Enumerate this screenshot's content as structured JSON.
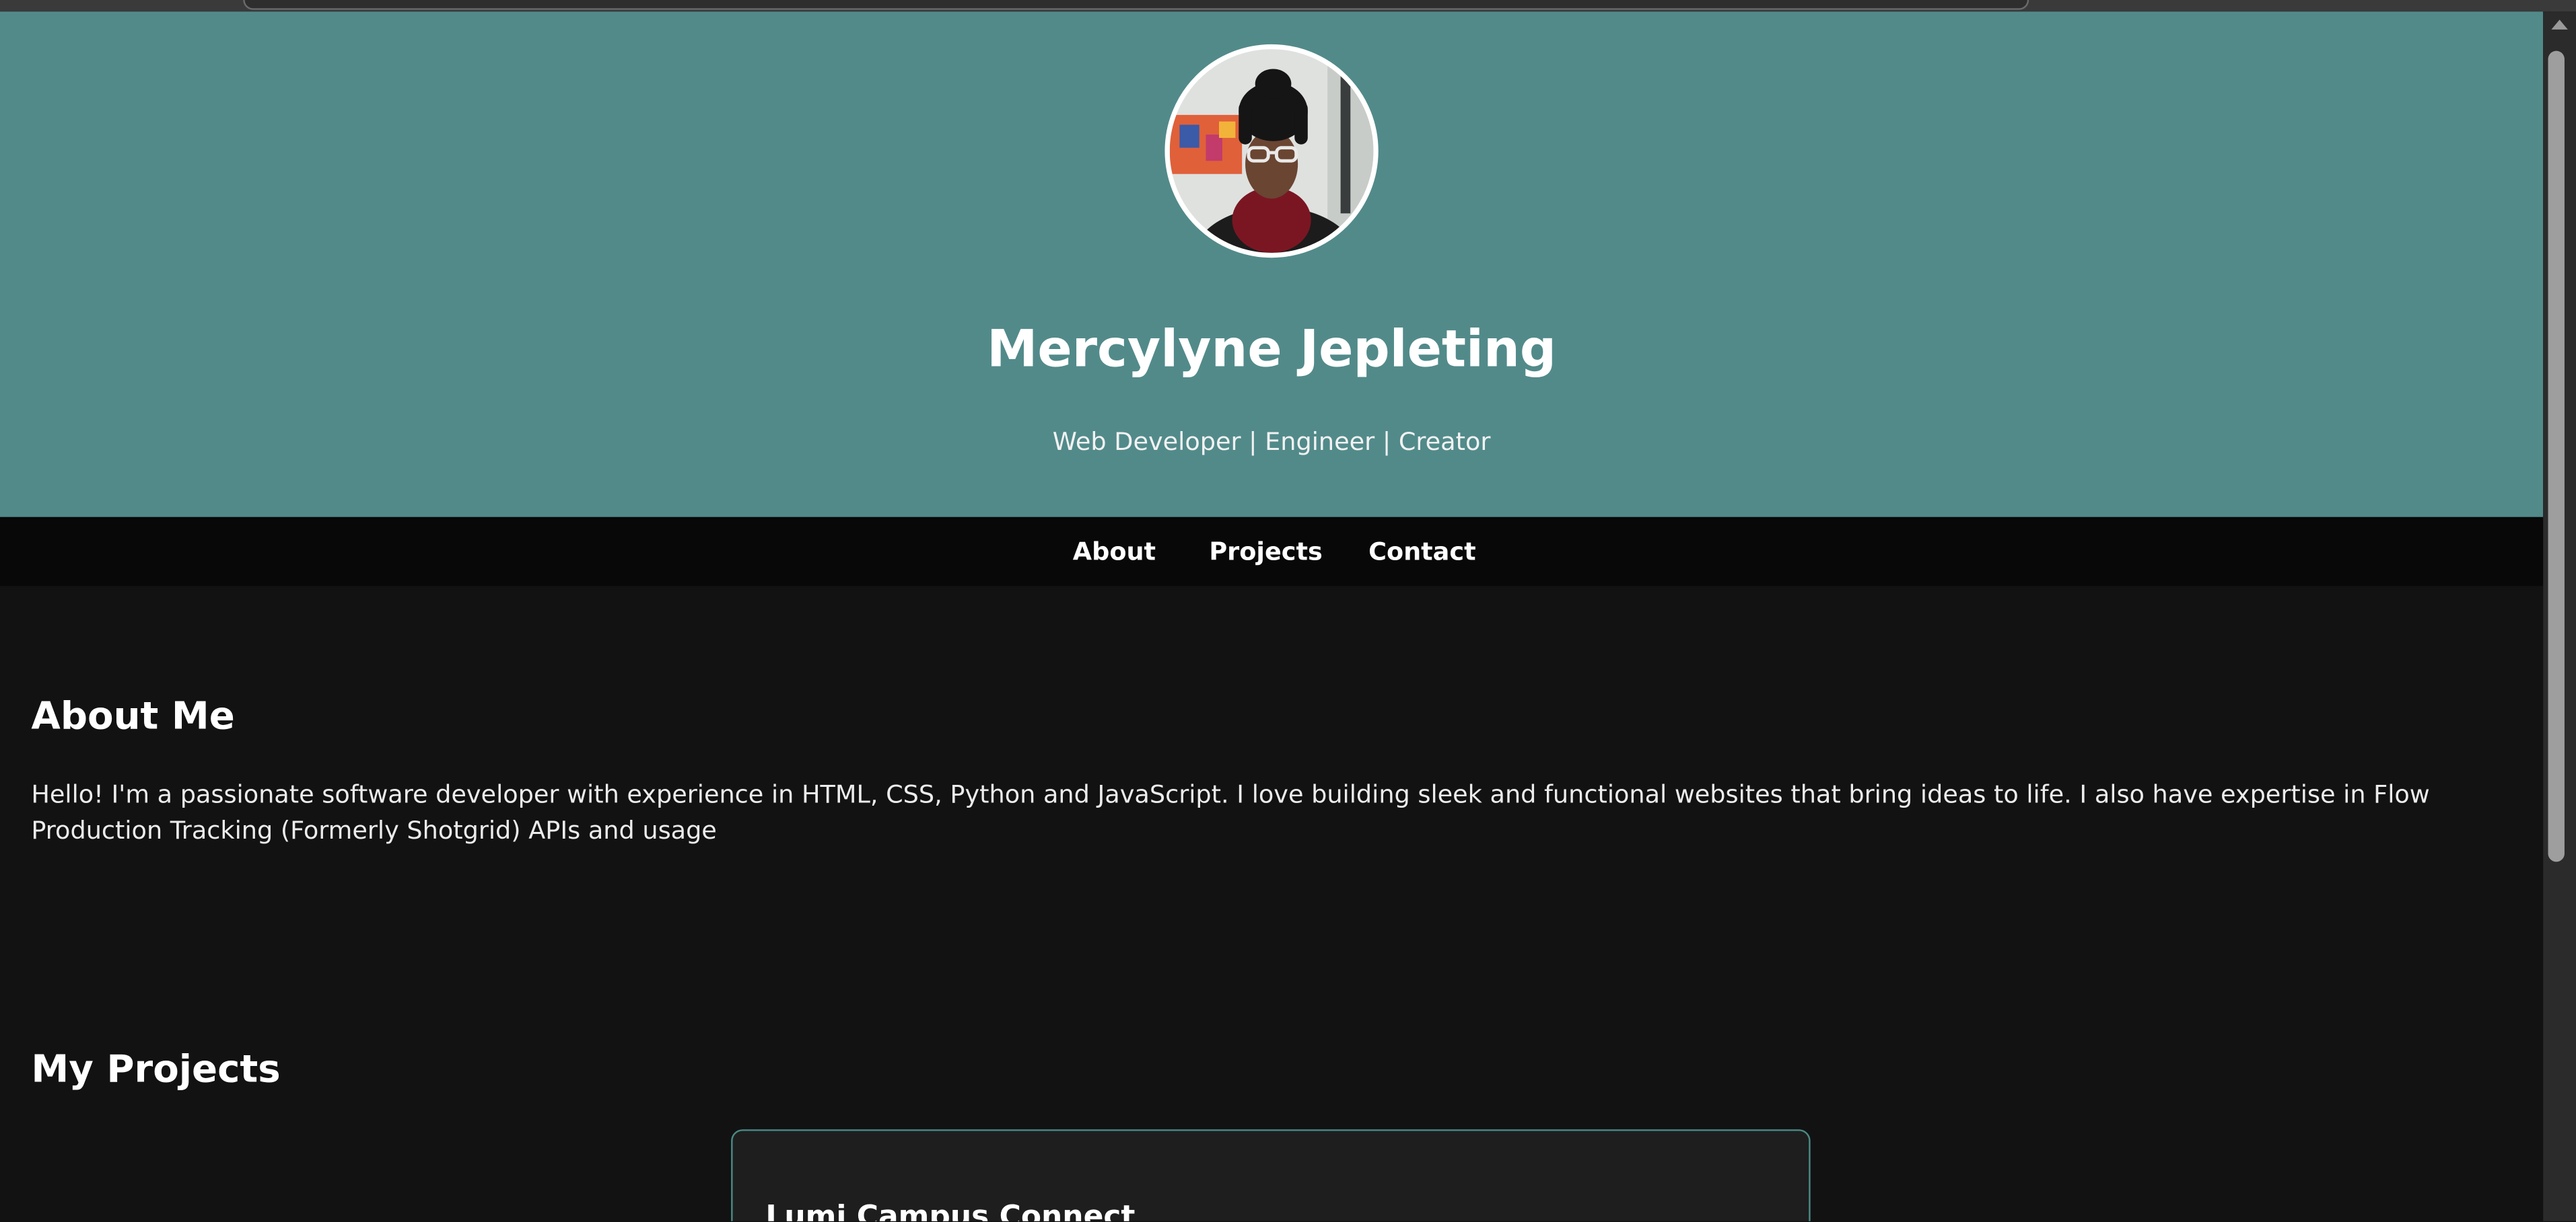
{
  "header": {
    "name": "Mercylyne Jepleting",
    "tagline": "Web Developer | Engineer | Creator",
    "avatar_alt": "Profile photo"
  },
  "nav": {
    "items": [
      {
        "label": "About"
      },
      {
        "label": "Projects"
      },
      {
        "label": "Contact"
      }
    ]
  },
  "about": {
    "title": "About Me",
    "text": "Hello! I'm a passionate software developer with experience in HTML, CSS, Python and JavaScript. I love building sleek and functional websites that bring ideas to life. I also have expertise in Flow Production Tracking (Formerly Shotgrid) APIs and usage"
  },
  "projects": {
    "title": "My Projects",
    "items": [
      {
        "title": "Lumi Campus Connect"
      }
    ]
  },
  "colors": {
    "hero_bg": "#528a8a",
    "page_bg": "#121212",
    "nav_bg": "#080808",
    "card_border": "#4a8a86"
  }
}
